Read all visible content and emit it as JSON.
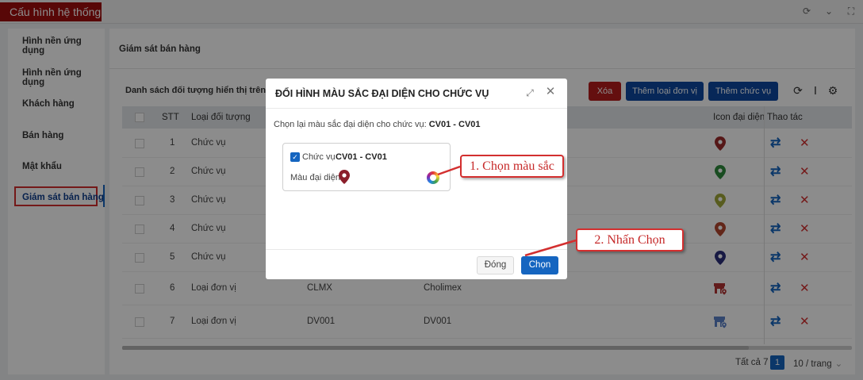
{
  "app": {
    "title": "Cấu hình hệ thống"
  },
  "sidebar": {
    "items": [
      {
        "label": "Hình nền ứng dụng"
      },
      {
        "label": "Hình nền ứng dụng"
      },
      {
        "label": "Khách hàng"
      },
      {
        "label": "Bán hàng"
      },
      {
        "label": "Mật khẩu"
      },
      {
        "label": "Giám sát bán hàng",
        "active": true
      }
    ]
  },
  "main": {
    "title": "Giám sát bán hàng",
    "list_title": "Danh sách đối tượng hiển thị trên màn",
    "buttons": {
      "delete": "Xóa",
      "add_unit": "Thêm loại đơn vị",
      "add_position": "Thêm chức vụ"
    }
  },
  "table": {
    "headers": {
      "stt": "STT",
      "type": "Loại đối tượng",
      "icon": "Icon đại diện",
      "actions": "Thao tác"
    },
    "rows": [
      {
        "stt": "1",
        "type": "Chức vụ",
        "code": "",
        "name": "",
        "icon": "pin",
        "color": "#9c2a2a"
      },
      {
        "stt": "2",
        "type": "Chức vụ",
        "code": "",
        "name": "",
        "icon": "pin",
        "color": "#2e8b3c"
      },
      {
        "stt": "3",
        "type": "Chức vụ",
        "code": "",
        "name": "",
        "icon": "pin",
        "color": "#a1a83a"
      },
      {
        "stt": "4",
        "type": "Chức vụ",
        "code": "",
        "name": "",
        "icon": "pin",
        "color": "#b3452f"
      },
      {
        "stt": "5",
        "type": "Chức vụ",
        "code": "",
        "name": "",
        "icon": "pin",
        "color": "#2a2f7a"
      },
      {
        "stt": "6",
        "type": "Loại đơn vị",
        "code": "CLMX",
        "name": "Cholimex",
        "icon": "store",
        "color": "#b23333"
      },
      {
        "stt": "7",
        "type": "Loại đơn vị",
        "code": "DV001",
        "name": "DV001",
        "icon": "store",
        "color": "#5b82c9"
      }
    ]
  },
  "pagination": {
    "total": "Tất cả 7",
    "page": "1",
    "page_size": "10 / trang"
  },
  "modal": {
    "title": "ĐỔI HÌNH MÀU SẮC ĐẠI DIỆN CHO CHỨC VỤ",
    "description_prefix": "Chọn lại màu sắc đại diện cho chức vụ:",
    "description_code": "CV01 - CV01",
    "card": {
      "label": "Chức vụ",
      "code": "CV01 - CV01",
      "color_label": "Màu đại diện",
      "pin_color": "#8b1e2b"
    },
    "close_label": "Đóng",
    "choose_label": "Chọn"
  },
  "callouts": {
    "step1": "1. Chọn màu sắc",
    "step2": "2. Nhấn Chọn"
  },
  "colors": {
    "accent": "#1565c0",
    "brand": "#a00e0e",
    "danger": "#b71c1c"
  }
}
